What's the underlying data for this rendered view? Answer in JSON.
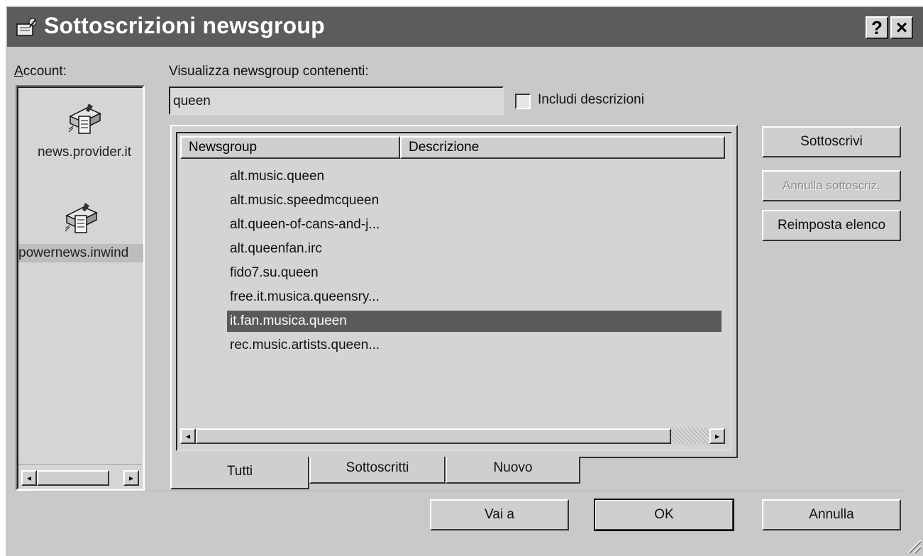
{
  "window": {
    "title": "Sottoscrizioni newsgroup",
    "help_label": "?",
    "close_label": "×"
  },
  "account": {
    "label": "Account:",
    "items": [
      {
        "name": "news.provider.it"
      },
      {
        "name": "powernews.inwind"
      }
    ]
  },
  "filter": {
    "label": "Visualizza newsgroup contenenti:",
    "value": "queen",
    "include_desc_label": "Includi descrizioni",
    "include_desc_checked": false
  },
  "list": {
    "columns": [
      "Newsgroup",
      "Descrizione"
    ],
    "rows": [
      "alt.music.queen",
      "alt.music.speedmcqueen",
      "alt.queen-of-cans-and-j...",
      "alt.queenfan.irc",
      "fido7.su.queen",
      "free.it.musica.queensry...",
      "it.fan.musica.queen",
      "rec.music.artists.queen..."
    ],
    "selected": "it.fan.musica.queen"
  },
  "tabs": [
    "Tutti",
    "Sottoscritti",
    "Nuovo"
  ],
  "active_tab": "Tutti",
  "side_buttons": {
    "subscribe": "Sottoscrivi",
    "unsubscribe": "Annulla sottoscriz.",
    "reset": "Reimposta elenco"
  },
  "bottom_buttons": {
    "goto": "Vai a",
    "ok": "OK",
    "cancel": "Annulla"
  },
  "colors": {
    "titlebar": "#5c5c5c",
    "face": "#c9c9c9",
    "selection": "#5a5a5a"
  }
}
